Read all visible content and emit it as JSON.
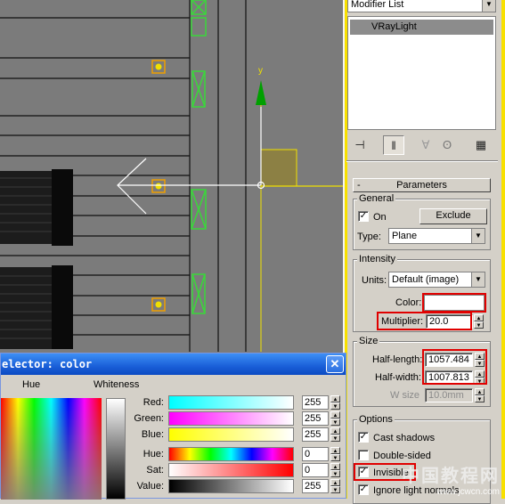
{
  "command_panel": {
    "modifier_list_label": "Modifier List",
    "modifier_stack": [
      "VRayLight"
    ],
    "rollout_title": "Parameters",
    "general": {
      "group_label": "General",
      "on_label": "On",
      "on_checked": true,
      "exclude_button": "Exclude",
      "type_label": "Type:",
      "type_value": "Plane"
    },
    "intensity": {
      "group_label": "Intensity",
      "units_label": "Units:",
      "units_value": "Default (image)",
      "color_label": "Color:",
      "color_swatch": "#ffffff",
      "multiplier_label": "Multiplier:",
      "multiplier_value": "20.0"
    },
    "size": {
      "group_label": "Size",
      "half_length_label": "Half-length:",
      "half_length_value": "1057.484",
      "half_width_label": "Half-width:",
      "half_width_value": "1007.813",
      "w_size_label": "W size",
      "w_size_value": "10.0mm"
    },
    "options": {
      "group_label": "Options",
      "cast_shadows_label": "Cast shadows",
      "cast_shadows_checked": true,
      "double_sided_label": "Double-sided",
      "double_sided_checked": false,
      "invisible_label": "Invisible",
      "invisible_checked": true,
      "ignore_normals_label": "Ignore light normals",
      "ignore_normals_checked": true
    },
    "highlight_color": "#e00000"
  },
  "color_dialog": {
    "title": "elector: color",
    "hue_label": "Hue",
    "whiteness_label": "Whiteness",
    "channels": [
      {
        "label": "Red:",
        "value": "255"
      },
      {
        "label": "Green:",
        "value": "255"
      },
      {
        "label": "Blue:",
        "value": "255"
      },
      {
        "label": "Hue:",
        "value": "0"
      },
      {
        "label": "Sat:",
        "value": "0"
      },
      {
        "label": "Value:",
        "value": "255"
      }
    ]
  },
  "watermark": {
    "text": "中国教程网",
    "url": "www.jcwcn.com"
  },
  "viewport": {
    "light_color": "#f0e000",
    "axis_y_color": "#00a000",
    "helper_color": "#3ad83a"
  }
}
